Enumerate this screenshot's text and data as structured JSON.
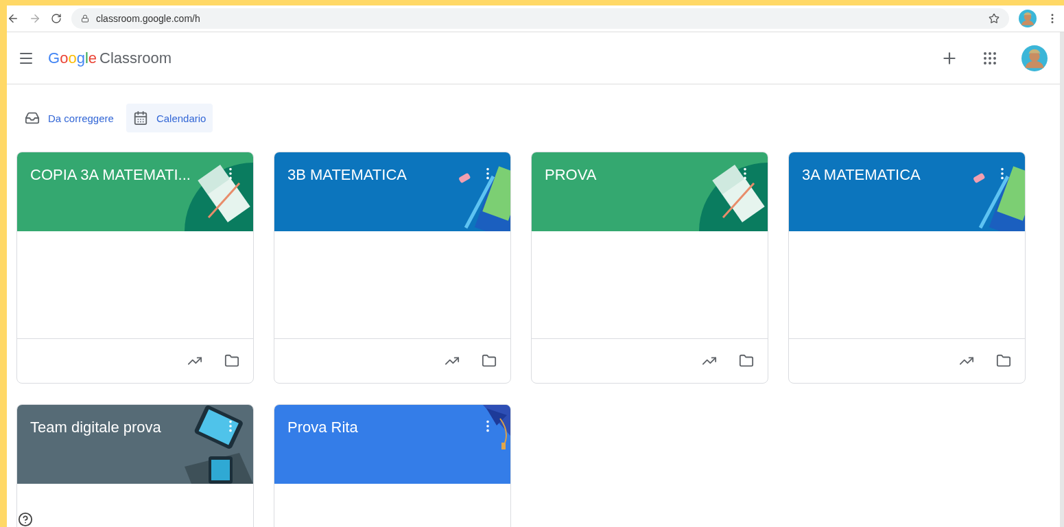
{
  "browser": {
    "url": "classroom.google.com/h"
  },
  "app": {
    "brand": "Google",
    "product": "Classroom"
  },
  "chips": [
    {
      "label": "Da correggere",
      "kind": "review",
      "selected": false
    },
    {
      "label": "Calendario",
      "kind": "calendar",
      "selected": true
    }
  ],
  "classes": [
    {
      "title": "COPIA 3A MATEMATI...",
      "color": "#34a870",
      "kind": "book"
    },
    {
      "title": "3B MATEMATICA",
      "color": "#0c75bd",
      "kind": "pencil"
    },
    {
      "title": "PROVA",
      "color": "#34a870",
      "kind": "book"
    },
    {
      "title": "3A MATEMATICA",
      "color": "#0c75bd",
      "kind": "pencil"
    },
    {
      "title": "Team digitale prova",
      "color": "#566b76",
      "kind": "tablet"
    },
    {
      "title": "Prova Rita",
      "color": "#347de8",
      "kind": "cap"
    }
  ]
}
